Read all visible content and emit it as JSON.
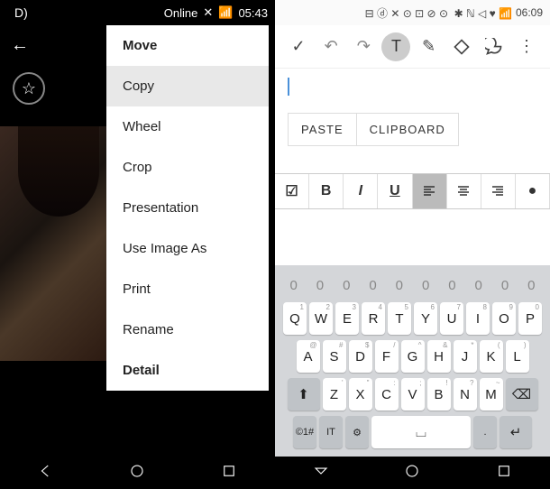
{
  "left_status": {
    "label": "D)",
    "text": "Online",
    "time": "05:43"
  },
  "right_status": {
    "time": "06:09"
  },
  "menu": {
    "items": [
      {
        "label": "Move"
      },
      {
        "label": "Copy"
      },
      {
        "label": "Wheel"
      },
      {
        "label": "Crop"
      },
      {
        "label": "Presentation"
      },
      {
        "label": "Use Image As"
      },
      {
        "label": "Print"
      },
      {
        "label": "Rename"
      },
      {
        "label": "Detail"
      }
    ]
  },
  "toolbar": {
    "check": "✓",
    "undo": "↶",
    "redo": "↷",
    "text": "T",
    "pen": "✎",
    "erase": "◇",
    "comment": "💬",
    "more": "⋮"
  },
  "paste": {
    "paste": "PASTE",
    "clipboard": "CLIPBOARD"
  },
  "format": {
    "check": "☑",
    "bold": "B",
    "italic": "I",
    "underline": "U",
    "dot": "●"
  },
  "keyboard": {
    "nums": [
      "0",
      "0",
      "0",
      "0",
      "0",
      "0",
      "0",
      "0",
      "0",
      "0"
    ],
    "row1": [
      {
        "k": "Q",
        "s": "1"
      },
      {
        "k": "W",
        "s": "2"
      },
      {
        "k": "E",
        "s": "3"
      },
      {
        "k": "R",
        "s": "4"
      },
      {
        "k": "T",
        "s": "5"
      },
      {
        "k": "Y",
        "s": "6"
      },
      {
        "k": "U",
        "s": "7"
      },
      {
        "k": "I",
        "s": "8"
      },
      {
        "k": "O",
        "s": "9"
      },
      {
        "k": "P",
        "s": "0"
      }
    ],
    "row2": [
      {
        "k": "A",
        "s": "@"
      },
      {
        "k": "S",
        "s": "#"
      },
      {
        "k": "D",
        "s": "$"
      },
      {
        "k": "F",
        "s": "/"
      },
      {
        "k": "G",
        "s": "^"
      },
      {
        "k": "H",
        "s": "&"
      },
      {
        "k": "J",
        "s": "*"
      },
      {
        "k": "K",
        "s": "("
      },
      {
        "k": "L",
        "s": ")"
      }
    ],
    "row3": [
      {
        "k": "Z",
        "s": "'"
      },
      {
        "k": "X",
        "s": "\""
      },
      {
        "k": "C",
        "s": ":"
      },
      {
        "k": "V",
        "s": ";"
      },
      {
        "k": "B",
        "s": "!"
      },
      {
        "k": "N",
        "s": "?"
      },
      {
        "k": "M",
        "s": "~"
      }
    ],
    "shift": "⬆",
    "backspace": "⌫",
    "sym": "©1#",
    "lang": "IT",
    "gear": "⚙",
    "enter": "↵"
  }
}
